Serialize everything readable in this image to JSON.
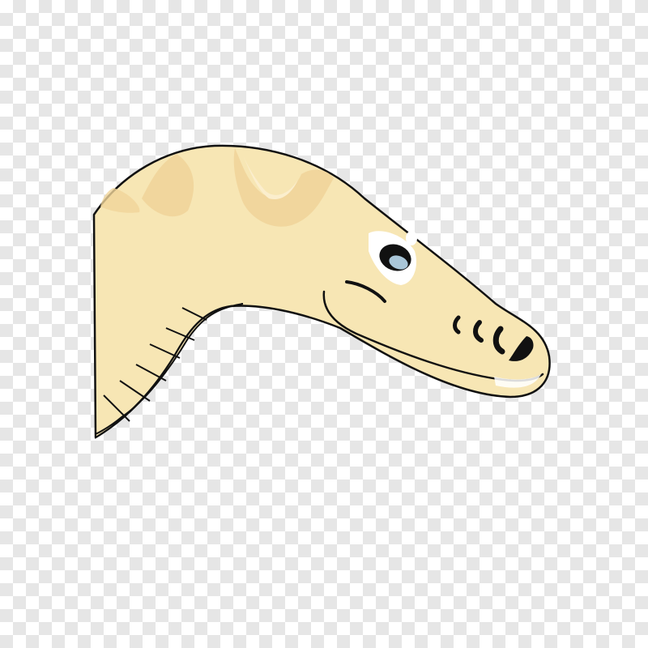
{
  "image": {
    "background": "transparency-checkerboard",
    "subject": "cartoon-dinosaur-head-icon",
    "colors": {
      "checker_light": "#ffffff",
      "checker_dark": "#e6e6e6",
      "skin": "#f7e6b4",
      "stripes": "#f0d49a",
      "belly_plates": "#f5e3b0",
      "outline": "#111111",
      "eye_iris": "#a9c6d8",
      "eye_highlight": "#ffffff"
    }
  }
}
